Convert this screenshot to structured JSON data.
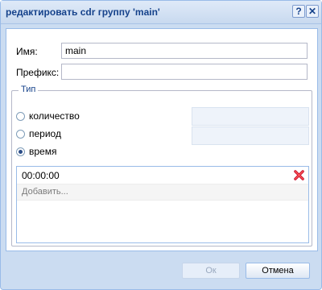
{
  "dialog": {
    "title": "редактировать cdr группу 'main'",
    "help_label": "?",
    "close_label": "✕"
  },
  "form": {
    "name_label": "Имя:",
    "name_value": "main",
    "prefix_label": "Префикс:",
    "prefix_value": ""
  },
  "type_group": {
    "legend": "Тип",
    "options": [
      {
        "label": "количество",
        "checked": false
      },
      {
        "label": "период",
        "checked": false
      },
      {
        "label": "время",
        "checked": true
      }
    ]
  },
  "time_grid": {
    "rows": [
      "00:00:00"
    ],
    "add_placeholder": "Добавить..."
  },
  "buttons": {
    "ok_label": "Ок",
    "cancel_label": "Отмена"
  }
}
